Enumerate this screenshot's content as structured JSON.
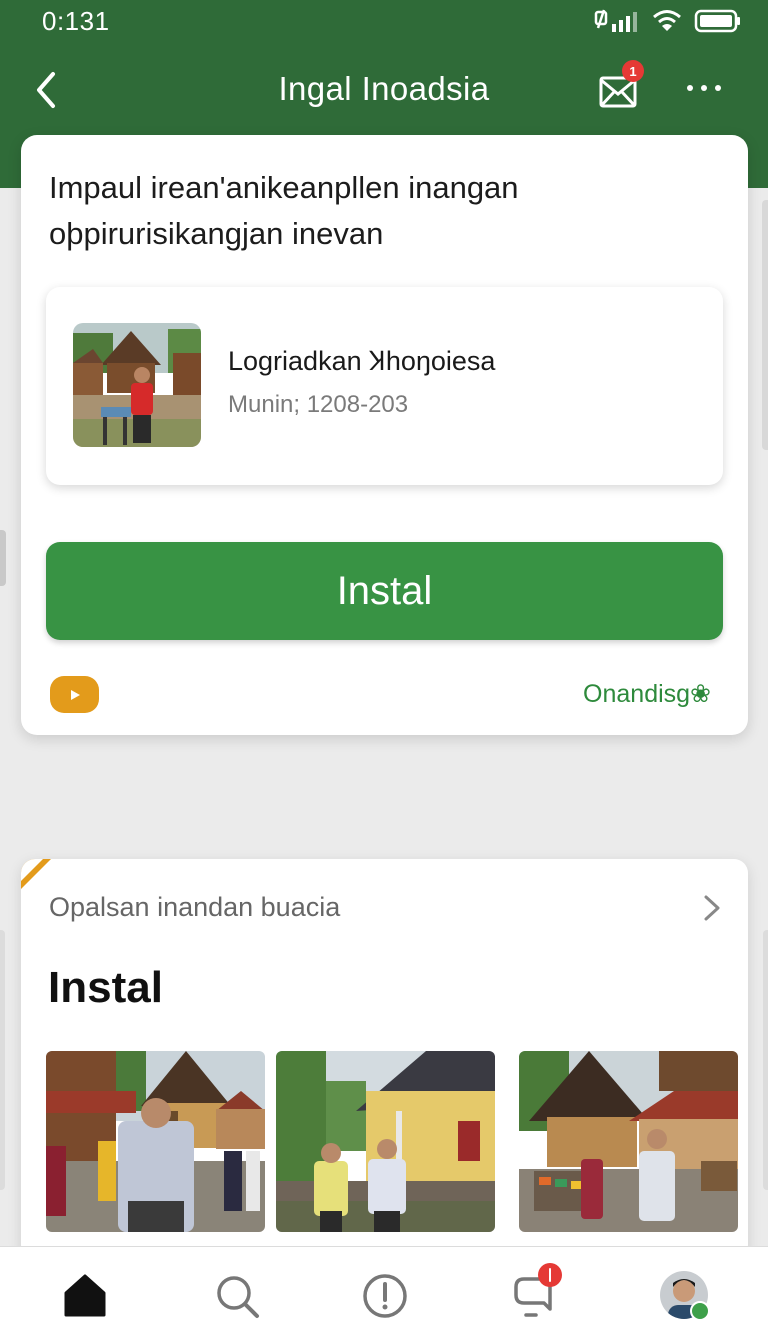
{
  "status_bar": {
    "time": "0:131"
  },
  "header": {
    "title": "Ingal Inoadsia",
    "mail_badge": "1"
  },
  "main_card": {
    "headline": "Impaul irean'anikeanpllen inangan oþpirurisikangjan inevan",
    "info": {
      "title": "Logriadkan Ʞhoŋoiesa",
      "meta": "Munin;  1208-203"
    },
    "install_label": "Instal",
    "brand_link": "Onandisg❀"
  },
  "second_card": {
    "subtitle": "Opalsan inandan buacia",
    "title": "Instal",
    "photos": [
      "village-photo-1",
      "village-photo-2",
      "village-photo-3"
    ]
  },
  "bottom_nav": {
    "items": [
      "home-icon",
      "search-icon",
      "alert-icon",
      "notifications-icon",
      "profile-avatar"
    ]
  },
  "colors": {
    "primary_green": "#389344",
    "header_green": "#2f6b38",
    "accent_orange": "#e39b1b",
    "badge_red": "#e53935",
    "link_green": "#2e8a3c"
  }
}
